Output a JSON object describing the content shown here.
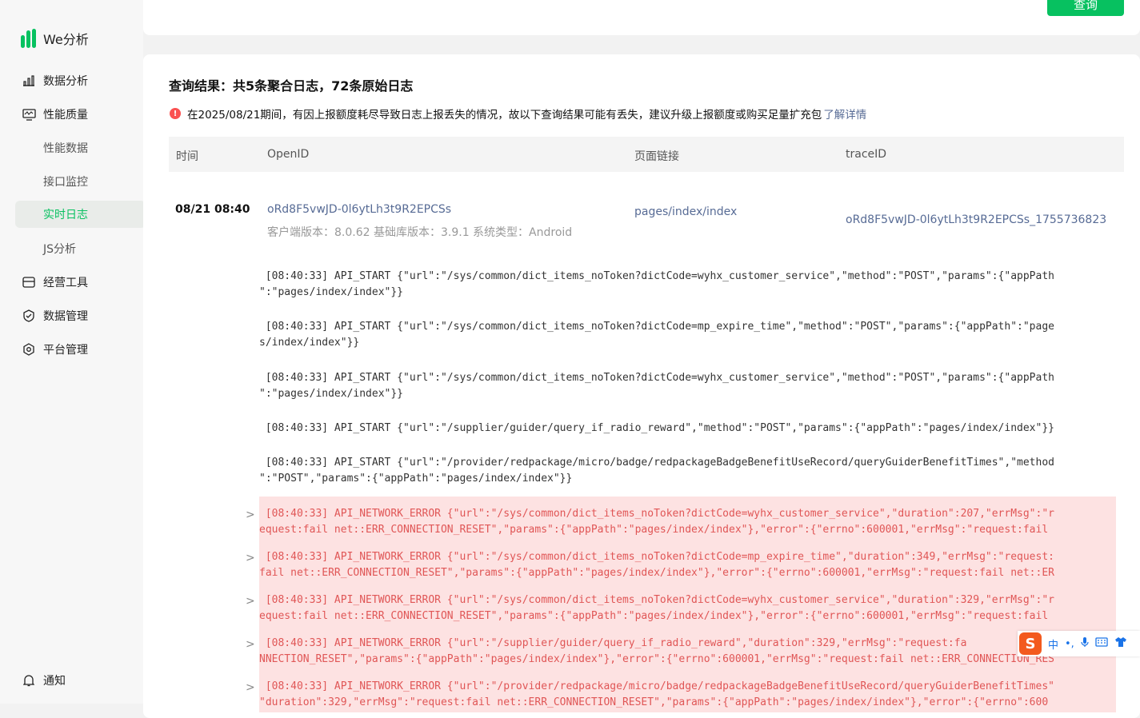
{
  "app": {
    "name": "We分析"
  },
  "sidebar": {
    "items": [
      {
        "label": "数据分析",
        "icon": "bar-chart-icon"
      },
      {
        "label": "性能质量",
        "icon": "monitor-icon"
      },
      {
        "label": "性能数据"
      },
      {
        "label": "接口监控"
      },
      {
        "label": "实时日志",
        "active": true
      },
      {
        "label": "JS分析"
      },
      {
        "label": "经营工具",
        "icon": "wallet-icon"
      },
      {
        "label": "数据管理",
        "icon": "shield-check-icon"
      },
      {
        "label": "平台管理",
        "icon": "hexagon-gear-icon"
      }
    ],
    "notify": {
      "label": "通知",
      "icon": "bell-icon"
    }
  },
  "query": {
    "button_label": "查询"
  },
  "result": {
    "title": "查询结果：共5条聚合日志，72条原始日志",
    "warning_text": "在2025/08/21期间，有因上报额度耗尽导致日志上报丢失的情况，故以下查询结果可能有丢失，建议升级上报额度或购买足量扩充包",
    "warning_link": "了解详情"
  },
  "table": {
    "headers": [
      "时间",
      "OpenID",
      "页面链接",
      "traceID"
    ],
    "row": {
      "time": "08/21 08:40",
      "openid": "oRd8F5vwJD-0l6ytLh3t9R2EPCSs",
      "client_info": "客户端版本：8.0.62 基础库版本：3.9.1 系统类型：Android",
      "page": "pages/index/index",
      "trace_id": "oRd8F5vwJD-0l6ytLh3t9R2EPCSs_1755736823"
    }
  },
  "logs": [
    {
      "type": "info",
      "line1": " [08:40:33] API_START {\"url\":\"/sys/common/dict_items_noToken?dictCode=wyhx_customer_service\",\"method\":\"POST\",\"params\":{\"appPath",
      "line2": "\":\"pages/index/index\"}}"
    },
    {
      "type": "info",
      "line1": " [08:40:33] API_START {\"url\":\"/sys/common/dict_items_noToken?dictCode=mp_expire_time\",\"method\":\"POST\",\"params\":{\"appPath\":\"page",
      "line2": "s/index/index\"}}"
    },
    {
      "type": "info",
      "line1": " [08:40:33] API_START {\"url\":\"/sys/common/dict_items_noToken?dictCode=wyhx_customer_service\",\"method\":\"POST\",\"params\":{\"appPath",
      "line2": "\":\"pages/index/index\"}}"
    },
    {
      "type": "info",
      "line1": " [08:40:33] API_START {\"url\":\"/supplier/guider/query_if_radio_reward\",\"method\":\"POST\",\"params\":{\"appPath\":\"pages/index/index\"}}",
      "line2": ""
    },
    {
      "type": "info",
      "line1": " [08:40:33] API_START {\"url\":\"/provider/redpackage/micro/badge/redpackageBadgeBenefitUseRecord/queryGuiderBenefitTimes\",\"method",
      "line2": "\":\"POST\",\"params\":{\"appPath\":\"pages/index/index\"}}"
    },
    {
      "type": "error",
      "line1": " [08:40:33] API_NETWORK_ERROR {\"url\":\"/sys/common/dict_items_noToken?dictCode=wyhx_customer_service\",\"duration\":207,\"errMsg\":\"r",
      "line2": "equest:fail net::ERR_CONNECTION_RESET\",\"params\":{\"appPath\":\"pages/index/index\"},\"error\":{\"errno\":600001,\"errMsg\":\"request:fail"
    },
    {
      "type": "error",
      "line1": " [08:40:33] API_NETWORK_ERROR {\"url\":\"/sys/common/dict_items_noToken?dictCode=mp_expire_time\",\"duration\":349,\"errMsg\":\"request:",
      "line2": "fail net::ERR_CONNECTION_RESET\",\"params\":{\"appPath\":\"pages/index/index\"},\"error\":{\"errno\":600001,\"errMsg\":\"request:fail net::ER"
    },
    {
      "type": "error",
      "line1": " [08:40:33] API_NETWORK_ERROR {\"url\":\"/sys/common/dict_items_noToken?dictCode=wyhx_customer_service\",\"duration\":329,\"errMsg\":\"r",
      "line2": "equest:fail net::ERR_CONNECTION_RESET\",\"params\":{\"appPath\":\"pages/index/index\"},\"error\":{\"errno\":600001,\"errMsg\":\"request:fail"
    },
    {
      "type": "error",
      "line1": " [08:40:33] API_NETWORK_ERROR {\"url\":\"/supplier/guider/query_if_radio_reward\",\"duration\":329,\"errMsg\":\"request:fa",
      "line2": "NNECTION_RESET\",\"params\":{\"appPath\":\"pages/index/index\"},\"error\":{\"errno\":600001,\"errMsg\":\"request:fail net::ERR_CONNECTION_RES"
    },
    {
      "type": "error",
      "line1": " [08:40:33] API_NETWORK_ERROR {\"url\":\"/provider/redpackage/micro/badge/redpackageBadgeBenefitUseRecord/queryGuiderBenefitTimes\"",
      "line2": "\"duration\":329,\"errMsg\":\"request:fail net::ERR_CONNECTION_RESET\",\"params\":{\"appPath\":\"pages/index/index\"},\"error\":{\"errno\":600"
    }
  ],
  "ime": {
    "logo": "S",
    "lang": "中",
    "punct": "•,"
  }
}
